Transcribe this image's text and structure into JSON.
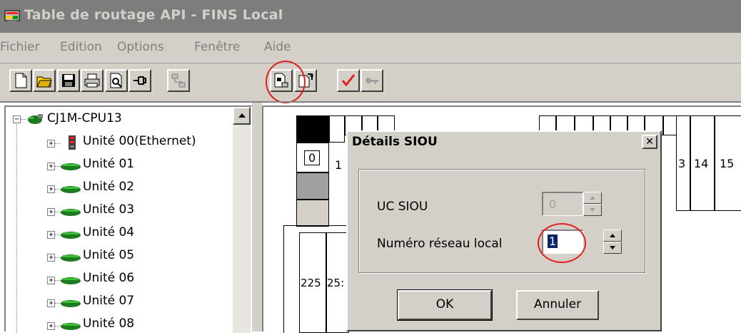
{
  "window": {
    "title": "Table de routage API - FINS Local"
  },
  "menu": [
    "Fichier",
    "Edition",
    "Options",
    "Fenêtre",
    "Aide"
  ],
  "toolbar": {
    "buttons": [
      "new-icon",
      "open-icon",
      "save-icon",
      "print-icon",
      "print-preview-icon",
      "pin-icon",
      "network-icon",
      "siou-details-icon",
      "transfer-icon",
      "check-icon",
      "key-icon"
    ]
  },
  "tree": {
    "root": "CJ1M-CPU13",
    "items": [
      {
        "label": "Unité 00(Ethernet)",
        "icon": "ethernet-unit-icon"
      },
      {
        "label": "Unité 01",
        "icon": "unit-icon"
      },
      {
        "label": "Unité 02",
        "icon": "unit-icon"
      },
      {
        "label": "Unité 03",
        "icon": "unit-icon"
      },
      {
        "label": "Unité 04",
        "icon": "unit-icon"
      },
      {
        "label": "Unité 05",
        "icon": "unit-icon"
      },
      {
        "label": "Unité 06",
        "icon": "unit-icon"
      },
      {
        "label": "Unité 07",
        "icon": "unit-icon"
      },
      {
        "label": "Unité 08",
        "icon": "unit-icon"
      }
    ]
  },
  "grid": {
    "top_numbers": [
      "0",
      "1",
      "3",
      "14",
      "15"
    ],
    "bottom_numbers": [
      "225",
      "25:"
    ]
  },
  "dialog": {
    "title": "Détails SIOU",
    "close": "✕",
    "uc_siou_label": "UC SIOU",
    "uc_siou_value": "0",
    "local_net_label": "Numéro réseau local",
    "local_net_value": "1",
    "ok": "OK",
    "cancel": "Annuler"
  },
  "colors": {
    "annotation": "#e0201f",
    "selection": "#0a246a"
  }
}
